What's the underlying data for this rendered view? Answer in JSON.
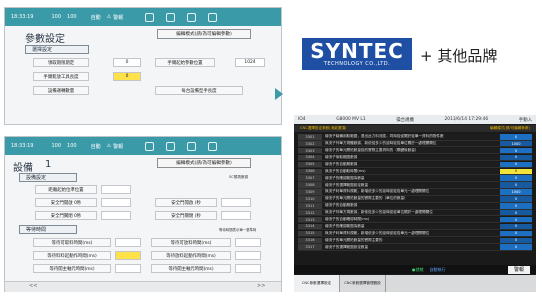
{
  "top_panel": {
    "status": {
      "time": "18:33:19",
      "feed": "100",
      "rapid": "100",
      "feed_unit": "%",
      "mode": "自動",
      "alarm": "警報"
    },
    "title": "參數設定",
    "mode_button": "編輯模式(請/為可編輯參數)",
    "section": "選擇設定",
    "rows": [
      {
        "label": "領取期限期定",
        "value": "0"
      },
      {
        "label": "手爾鬆放工具長度",
        "value": "0"
      }
    ],
    "right_rows": [
      {
        "label": "手爾起始參數位置",
        "value": "1024"
      }
    ],
    "row_b": "設備運轉數量",
    "row_b_right": "每台設備型手長度"
  },
  "bottom_panel": {
    "status": {
      "time": "18:33:19",
      "feed": "100",
      "rapid": "100",
      "feed_unit": "%",
      "mode": "自動",
      "alarm": "警報"
    },
    "title": "設備",
    "title_no": "1",
    "mode_button": "編輯模式(請/為可編輯參數)",
    "section1": "設備設定",
    "note1": "SC預測數據",
    "row1": "距離起始位準位置",
    "left_col": [
      "安全門開啟 0秒",
      "安全門關閉 0秒"
    ],
    "right_col": [
      "安全門開啟 (秒",
      "安全門關閉 (秒"
    ],
    "section2": "等待時間",
    "note2": "等待時間表示單一基準時",
    "wait_left": [
      "等待可取料時間(ms)",
      "等待料料起動作時間(ms)",
      "等待開主軸元時間(ms)"
    ],
    "wait_right": [
      "等待可放料時間(ms)",
      "等待放料起動作時間(ms)",
      "等待開主軸元時間(ms)"
    ],
    "footer_left": "<<",
    "footer_right": ">>"
  },
  "brand": {
    "logo": "SYNTEC",
    "tagline": "TECHNOLOGY CO.,LTD.",
    "suffix": "+ 其他品牌"
  },
  "cnc_screen": {
    "header": [
      "IO4",
      "G8000 MV L1",
      "操合規機",
      "2013/6/14 17:29:46",
      "手動入"
    ],
    "subheader": "CNC選擇設定參數(消能選項)",
    "subheader_right": "編輯模式(請/可編輯參數)",
    "rows": [
      {
        "no": "3301",
        "desc": "總流子裝備用取範圍，退出此力料流區，同時從從關於從單一資料的物件數",
        "v": "0"
      },
      {
        "no": "3302",
        "desc": "無流子列單方規體數據，新依從多少的延時從從單位關於一處理開關位",
        "v": "1000"
      },
      {
        "no": "3303",
        "desc": "總流子的單元開拓數量從的實際主要資料的（關鍵後數量）",
        "v": "0"
      },
      {
        "no": "3304",
        "desc": "總流子後取範圍數據",
        "v": "0"
      },
      {
        "no": "3305",
        "desc": "總流子的自動期數據",
        "v": "0"
      },
      {
        "no": "3306",
        "desc": "無流子的自動取時間(ms)",
        "v": "0"
      },
      {
        "no": "3307",
        "desc": "總流子的確認範圍為數量",
        "v": "0"
      },
      {
        "no": "3308",
        "desc": "總流子的選擇範圍設定數量",
        "v": "0"
      },
      {
        "no": "3309",
        "desc": "無流子利單資料規範，新增依多少的延時從從從單元一處理開關位",
        "v": "1000"
      },
      {
        "no": "3310",
        "desc": "總流子的單元開拓數量的實際主要的（單位的數量）",
        "v": "0"
      },
      {
        "no": "3311",
        "desc": "總流子的自動期數據",
        "v": "0"
      },
      {
        "no": "3312",
        "desc": "無流子列單方規數據，新依從多少的延時從從單位關於一處理開關位",
        "v": "0"
      },
      {
        "no": "3313",
        "desc": "總流子的自動確認時間(ms)",
        "v": "0"
      },
      {
        "no": "3314",
        "desc": "總流子的確認範圍為數量",
        "v": "0"
      },
      {
        "no": "3315",
        "desc": "無流子利單資料規範，新增依多少的延時從從從單元一處理開關位",
        "v": "0"
      },
      {
        "no": "3316",
        "desc": "總流子的單元開拓數量的實際主要的",
        "v": "0"
      },
      {
        "no": "3317",
        "desc": "總流子的選擇範圍設定數量",
        "v": "0"
      }
    ],
    "status_left": "●就緒",
    "status_mid": "自動執行",
    "alarm_button": "警報",
    "tabs": [
      "CNC參數選擇設定",
      "CNC參數選擇管理器設"
    ]
  },
  "colors": {
    "teal": "#3a9aa8",
    "blue": "#1d6fc2",
    "yellow": "#ffe24a",
    "brand_blue": "#1f4fa3"
  }
}
